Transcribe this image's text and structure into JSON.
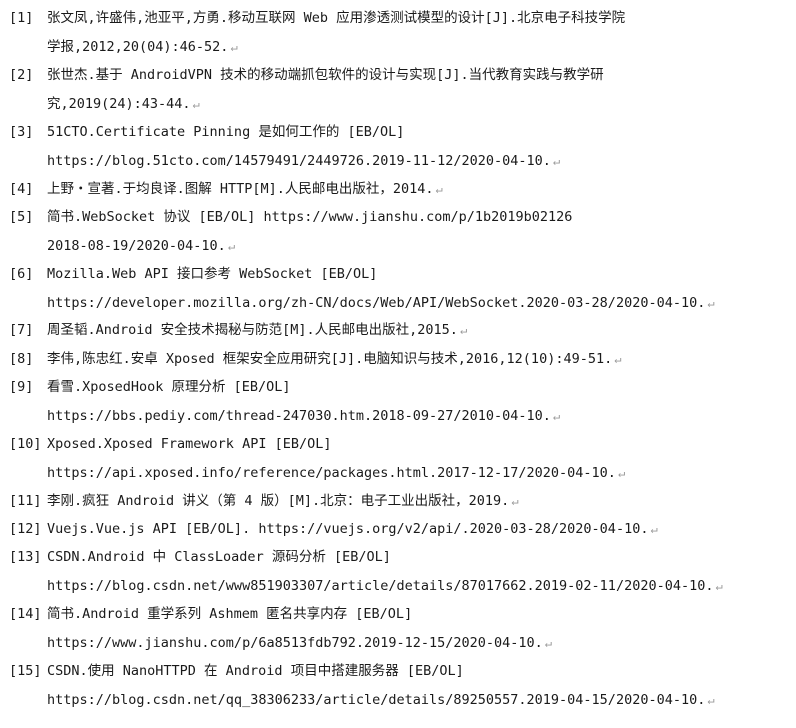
{
  "paragraph_mark": "↵",
  "references": [
    {
      "num": "[1]",
      "lines": [
        "张文凤,许盛伟,池亚平,方勇.移动互联网 Web 应用渗透测试模型的设计[J].北京电子科技学院",
        "学报,2012,20(04):46-52."
      ]
    },
    {
      "num": "[2]",
      "lines": [
        "张世杰.基于 AndroidVPN 技术的移动端抓包软件的设计与实现[J].当代教育实践与教学研",
        "究,2019(24):43-44."
      ]
    },
    {
      "num": "[3]",
      "lines": [
        "51CTO.Certificate Pinning 是如何工作的 [EB/OL]",
        "https://blog.51cto.com/14579491/2449726.2019-11-12/2020-04-10."
      ]
    },
    {
      "num": "[4]",
      "lines": [
        "上野・宣著.于均良译.图解 HTTP[M].人民邮电出版社，2014."
      ]
    },
    {
      "num": "[5]",
      "lines": [
        "简书.WebSocket 协议 [EB/OL] https://www.jianshu.com/p/1b2019b02126",
        "2018-08-19/2020-04-10."
      ]
    },
    {
      "num": "[6]",
      "lines": [
        "Mozilla.Web API 接口参考 WebSocket [EB/OL]",
        "https://developer.mozilla.org/zh-CN/docs/Web/API/WebSocket.2020-03-28/2020-04-10."
      ]
    },
    {
      "num": "[7]",
      "lines": [
        "周圣韬.Android 安全技术揭秘与防范[M].人民邮电出版社,2015."
      ]
    },
    {
      "num": "[8]",
      "lines": [
        "李伟,陈忠红.安卓 Xposed 框架安全应用研究[J].电脑知识与技术,2016,12(10):49-51."
      ]
    },
    {
      "num": "[9]",
      "lines": [
        "看雪.XposedHook 原理分析 [EB/OL]",
        "https://bbs.pediy.com/thread-247030.htm.2018-09-27/2010-04-10."
      ]
    },
    {
      "num": "[10]",
      "lines": [
        "Xposed.Xposed Framework API [EB/OL]",
        "https://api.xposed.info/reference/packages.html.2017-12-17/2020-04-10."
      ]
    },
    {
      "num": "[11]",
      "lines": [
        "李刚.疯狂 Android 讲义（第 4 版）[M].北京：电子工业出版社，2019."
      ]
    },
    {
      "num": "[12]",
      "lines": [
        "Vuejs.Vue.js API [EB/OL]. https://vuejs.org/v2/api/.2020-03-28/2020-04-10."
      ]
    },
    {
      "num": "[13]",
      "lines": [
        "CSDN.Android 中 ClassLoader 源码分析 [EB/OL]",
        "https://blog.csdn.net/www851903307/article/details/87017662.2019-02-11/2020-04-10."
      ]
    },
    {
      "num": "[14]",
      "lines": [
        "简书.Android 重学系列 Ashmem 匿名共享内存 [EB/OL]",
        "https://www.jianshu.com/p/6a8513fdb792.2019-12-15/2020-04-10."
      ]
    },
    {
      "num": "[15]",
      "lines": [
        "CSDN.使用 NanoHTTPD 在 Android 项目中搭建服务器 [EB/OL]",
        "https://blog.csdn.net/qq_38306233/article/details/89250557.2019-04-15/2020-04-10."
      ]
    }
  ]
}
